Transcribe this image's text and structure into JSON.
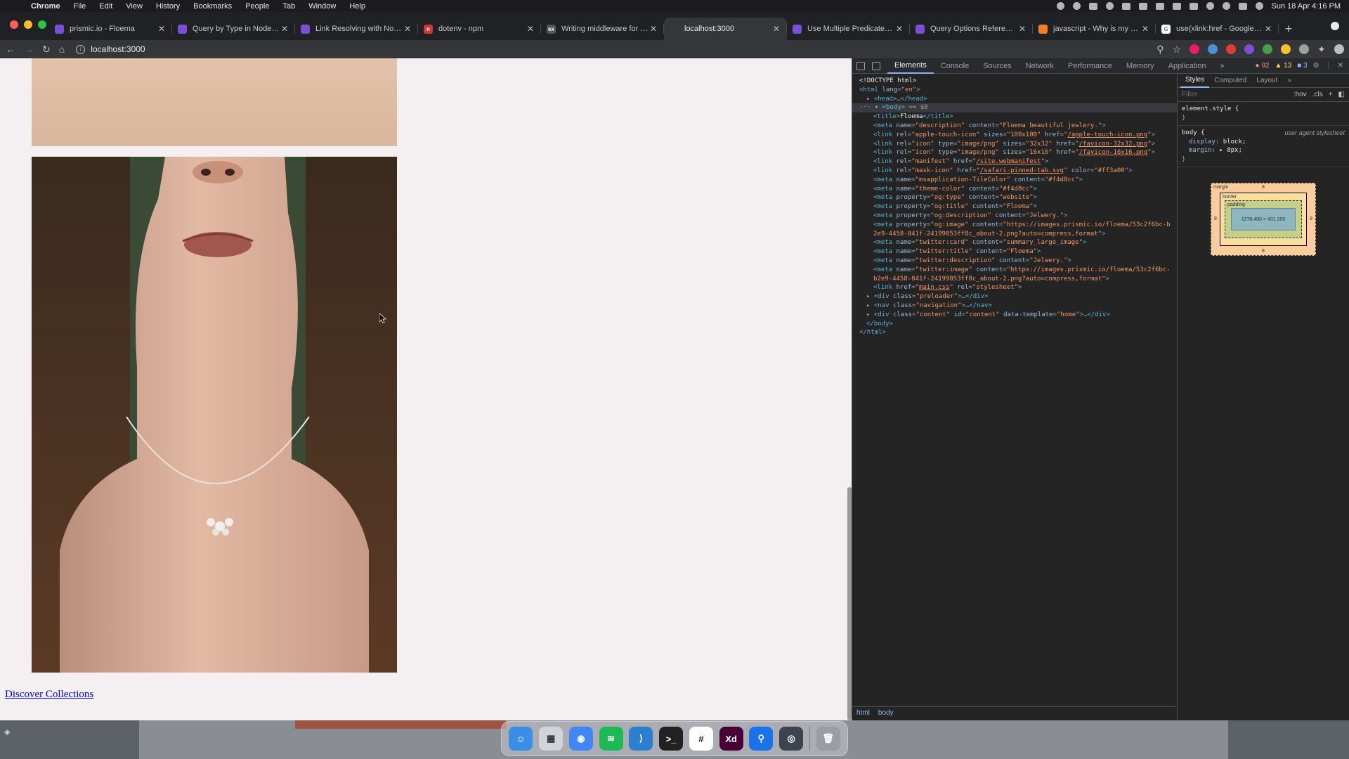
{
  "menubar": {
    "app": "Chrome",
    "items": [
      "File",
      "Edit",
      "View",
      "History",
      "Bookmarks",
      "People",
      "Tab",
      "Window",
      "Help"
    ],
    "clock": "Sun 18 Apr  4:16 PM"
  },
  "tabs": [
    {
      "label": "prismic.io - Floema",
      "fav_color": "#7b4fd6",
      "fav_text": ""
    },
    {
      "label": "Query by Type in Node.js - Pri",
      "fav_color": "#7b4fd6",
      "fav_text": ""
    },
    {
      "label": "Link Resolving with Node.js - ",
      "fav_color": "#7b4fd6",
      "fav_text": ""
    },
    {
      "label": "dotenv - npm",
      "fav_color": "#cb3837",
      "fav_text": "n"
    },
    {
      "label": "Writing middleware for use in",
      "fav_color": "#555555",
      "fav_text": "ex"
    },
    {
      "label": "localhost:3000",
      "fav_color": "#35363a",
      "fav_text": ""
    },
    {
      "label": "Use Multiple Predicates in Jav",
      "fav_color": "#7b4fd6",
      "fav_text": ""
    },
    {
      "label": "Query Options Reference in J",
      "fav_color": "#7b4fd6",
      "fav_text": ""
    },
    {
      "label": "javascript - Why is my middle",
      "fav_color": "#f48024",
      "fav_text": ""
    },
    {
      "label": "use(xlink:href - Google Searc",
      "fav_color": "#ffffff",
      "fav_text": "G"
    }
  ],
  "active_tab_index": 5,
  "address": "localhost:3000",
  "page": {
    "link": "Discover Collections"
  },
  "devtools": {
    "tabs": [
      "Elements",
      "Console",
      "Sources",
      "Network",
      "Performance",
      "Memory",
      "Application"
    ],
    "more": "»",
    "errors": "92",
    "warnings": "13",
    "info": "3",
    "crumbs": [
      "html",
      "body"
    ],
    "styles_tabs": [
      "Styles",
      "Computed",
      "Layout"
    ],
    "filter_placeholder": "Filter",
    "hov": ":hov",
    "cls": ".cls",
    "element_style": "element.style {",
    "close_brace": "}",
    "body_selector": "body {",
    "ua_label": "user agent stylesheet",
    "body_props": [
      {
        "name": "display",
        "value": "block;"
      },
      {
        "name": "margin",
        "value": "▸ 8px;"
      }
    ],
    "box_model": {
      "margin_label": "margin",
      "margin_value": "8",
      "border_label": "border",
      "padding_label": "padding",
      "content_size": "1278.400 × 431.200",
      "dash": "-"
    }
  },
  "source_lines": [
    {
      "indent": 0,
      "html": "<span class=\"tx\">&lt;!DOCTYPE html&gt;</span>"
    },
    {
      "indent": 0,
      "html": "<span class=\"tg\">&lt;html</span> <span class=\"an\">lang</span>=<span class=\"av\">\"en\"</span><span class=\"tg\">&gt;</span>"
    },
    {
      "indent": 1,
      "html": "▸ <span class=\"tg\">&lt;head&gt;</span>…<span class=\"tg\">&lt;/head&gt;</span>"
    },
    {
      "indent": 0,
      "sel": true,
      "html": "··· ▾ <span class=\"tg\">&lt;body&gt;</span> <span class=\"cm\">== $0</span>"
    },
    {
      "indent": 2,
      "html": "<span class=\"tg\">&lt;title&gt;</span><span class=\"tx\">Floema</span><span class=\"tg\">&lt;/title&gt;</span>"
    },
    {
      "indent": 2,
      "html": "<span class=\"tg\">&lt;meta</span> <span class=\"an\">name</span>=<span class=\"av\">\"description\"</span> <span class=\"an\">content</span>=<span class=\"av\">\"Floema beautiful jewlery.\"</span><span class=\"tg\">&gt;</span>"
    },
    {
      "indent": 2,
      "html": "<span class=\"tg\">&lt;link</span> <span class=\"an\">rel</span>=<span class=\"av\">\"apple-touch-icon\"</span> <span class=\"an\">sizes</span>=<span class=\"av\">\"180x180\"</span> <span class=\"an\">href</span>=<span class=\"av\">\"<span class=\"lk\">/apple-touch-icon.png</span>\"</span><span class=\"tg\">&gt;</span>"
    },
    {
      "indent": 2,
      "html": "<span class=\"tg\">&lt;link</span> <span class=\"an\">rel</span>=<span class=\"av\">\"icon\"</span> <span class=\"an\">type</span>=<span class=\"av\">\"image/png\"</span> <span class=\"an\">sizes</span>=<span class=\"av\">\"32x32\"</span> <span class=\"an\">href</span>=<span class=\"av\">\"<span class=\"lk\">/favicon-32x32.png</span>\"</span><span class=\"tg\">&gt;</span>"
    },
    {
      "indent": 2,
      "html": "<span class=\"tg\">&lt;link</span> <span class=\"an\">rel</span>=<span class=\"av\">\"icon\"</span> <span class=\"an\">type</span>=<span class=\"av\">\"image/png\"</span> <span class=\"an\">sizes</span>=<span class=\"av\">\"16x16\"</span> <span class=\"an\">href</span>=<span class=\"av\">\"<span class=\"lk\">/favicon-16x16.png</span>\"</span><span class=\"tg\">&gt;</span>"
    },
    {
      "indent": 2,
      "html": "<span class=\"tg\">&lt;link</span> <span class=\"an\">rel</span>=<span class=\"av\">\"manifest\"</span> <span class=\"an\">href</span>=<span class=\"av\">\"<span class=\"lk\">/site.webmanifest</span>\"</span><span class=\"tg\">&gt;</span>"
    },
    {
      "indent": 2,
      "html": "<span class=\"tg\">&lt;link</span> <span class=\"an\">rel</span>=<span class=\"av\">\"mask-icon\"</span> <span class=\"an\">href</span>=<span class=\"av\">\"<span class=\"lk\">/safari-pinned-tab.svg</span>\"</span> <span class=\"an\">color</span>=<span class=\"av\">\"#ff3a00\"</span><span class=\"tg\">&gt;</span>"
    },
    {
      "indent": 2,
      "html": "<span class=\"tg\">&lt;meta</span> <span class=\"an\">name</span>=<span class=\"av\">\"msapplication-TileColor\"</span> <span class=\"an\">content</span>=<span class=\"av\">\"#f4d8cc\"</span><span class=\"tg\">&gt;</span>"
    },
    {
      "indent": 2,
      "html": "<span class=\"tg\">&lt;meta</span> <span class=\"an\">name</span>=<span class=\"av\">\"theme-color\"</span> <span class=\"an\">content</span>=<span class=\"av\">\"#f4d8cc\"</span><span class=\"tg\">&gt;</span>"
    },
    {
      "indent": 2,
      "html": "<span class=\"tg\">&lt;meta</span> <span class=\"an\">property</span>=<span class=\"av\">\"og:type\"</span> <span class=\"an\">content</span>=<span class=\"av\">\"website\"</span><span class=\"tg\">&gt;</span>"
    },
    {
      "indent": 2,
      "html": "<span class=\"tg\">&lt;meta</span> <span class=\"an\">property</span>=<span class=\"av\">\"og:title\"</span> <span class=\"an\">content</span>=<span class=\"av\">\"Floema\"</span><span class=\"tg\">&gt;</span>"
    },
    {
      "indent": 2,
      "html": "<span class=\"tg\">&lt;meta</span> <span class=\"an\">property</span>=<span class=\"av\">\"og:description\"</span> <span class=\"an\">content</span>=<span class=\"av\">\"Jelwery.\"</span><span class=\"tg\">&gt;</span>"
    },
    {
      "indent": 2,
      "html": "<span class=\"tg\">&lt;meta</span> <span class=\"an\">property</span>=<span class=\"av\">\"og:image\"</span> <span class=\"an\">content</span>=<span class=\"av\">\"https://images.prismic.io/floema/53c2f6bc-b</span>"
    },
    {
      "indent": 2,
      "html": "<span class=\"av\">2e9-4458-841f-24199053ff8c_about-2.png?auto=compress,format\"</span><span class=\"tg\">&gt;</span>"
    },
    {
      "indent": 2,
      "html": "<span class=\"tg\">&lt;meta</span> <span class=\"an\">name</span>=<span class=\"av\">\"twitter:card\"</span> <span class=\"an\">content</span>=<span class=\"av\">\"summary_large_image\"</span><span class=\"tg\">&gt;</span>"
    },
    {
      "indent": 2,
      "html": "<span class=\"tg\">&lt;meta</span> <span class=\"an\">name</span>=<span class=\"av\">\"twitter:title\"</span> <span class=\"an\">content</span>=<span class=\"av\">\"Floema\"</span><span class=\"tg\">&gt;</span>"
    },
    {
      "indent": 2,
      "html": "<span class=\"tg\">&lt;meta</span> <span class=\"an\">name</span>=<span class=\"av\">\"twitter:description\"</span> <span class=\"an\">content</span>=<span class=\"av\">\"Jelwery.\"</span><span class=\"tg\">&gt;</span>"
    },
    {
      "indent": 2,
      "html": "<span class=\"tg\">&lt;meta</span> <span class=\"an\">name</span>=<span class=\"av\">\"twitter:image\"</span> <span class=\"an\">content</span>=<span class=\"av\">\"https://images.prismic.io/floema/53c2f6bc-</span>"
    },
    {
      "indent": 2,
      "html": "<span class=\"av\">b2e9-4458-841f-24199053ff8c_about-2.png?auto=compress,format\"</span><span class=\"tg\">&gt;</span>"
    },
    {
      "indent": 2,
      "html": "<span class=\"tg\">&lt;link</span> <span class=\"an\">href</span>=<span class=\"av\">\"<span class=\"lk\">main.css</span>\"</span> <span class=\"an\">rel</span>=<span class=\"av\">\"stylesheet\"</span><span class=\"tg\">&gt;</span>"
    },
    {
      "indent": 1,
      "html": "▸ <span class=\"tg\">&lt;div</span> <span class=\"an\">class</span>=<span class=\"av\">\"preloader\"</span><span class=\"tg\">&gt;</span>…<span class=\"tg\">&lt;/div&gt;</span>"
    },
    {
      "indent": 1,
      "html": "▸ <span class=\"tg\">&lt;nav</span> <span class=\"an\">class</span>=<span class=\"av\">\"navigation\"</span><span class=\"tg\">&gt;</span>…<span class=\"tg\">&lt;/nav&gt;</span>"
    },
    {
      "indent": 1,
      "html": "▸ <span class=\"tg\">&lt;div</span> <span class=\"an\">class</span>=<span class=\"av\">\"content\"</span> <span class=\"an\">id</span>=<span class=\"av\">\"content\"</span> <span class=\"an\">data-template</span>=<span class=\"av\">\"home\"</span><span class=\"tg\">&gt;</span>…<span class=\"tg\">&lt;/div&gt;</span>"
    },
    {
      "indent": 1,
      "html": "<span class=\"tg\">&lt;/body&gt;</span>"
    },
    {
      "indent": 0,
      "html": "<span class=\"tg\">&lt;/html&gt;</span>"
    }
  ],
  "dock": [
    {
      "name": "finder",
      "color": "#3a8ee6",
      "glyph": "☺"
    },
    {
      "name": "launchpad",
      "color": "#d0d4da",
      "glyph": "▦"
    },
    {
      "name": "chrome",
      "color": "#4285f4",
      "glyph": "◉"
    },
    {
      "name": "spotify",
      "color": "#1db954",
      "glyph": "≋"
    },
    {
      "name": "vscode",
      "color": "#2c7fd0",
      "glyph": "⟩"
    },
    {
      "name": "terminal",
      "color": "#222222",
      "glyph": ">_"
    },
    {
      "name": "slack",
      "color": "#ffffff",
      "glyph": "#"
    },
    {
      "name": "adobe-xd",
      "color": "#470137",
      "glyph": "Xd"
    },
    {
      "name": "maps",
      "color": "#1a73e8",
      "glyph": "⚲"
    },
    {
      "name": "quicktime",
      "color": "#3d4450",
      "glyph": "◎"
    },
    {
      "name": "trash",
      "color": "#9a9ea4",
      "glyph": "🗑"
    }
  ]
}
